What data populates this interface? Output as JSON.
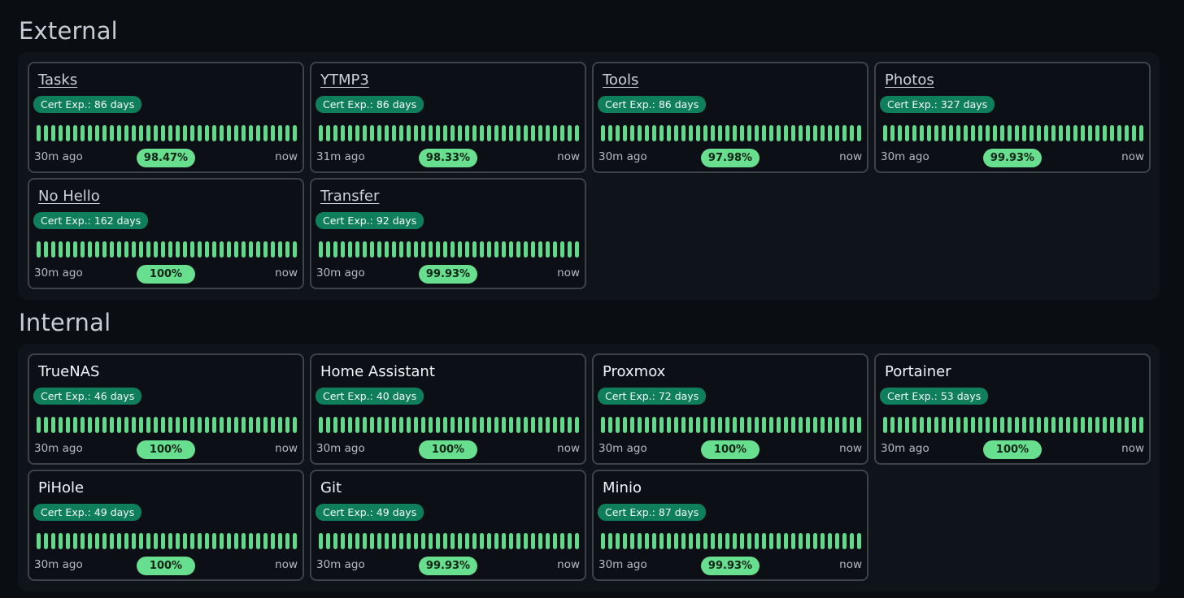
{
  "colors": {
    "background": "#0a0d12",
    "panel": "#0f131a",
    "card_border": "#3f4348",
    "cert_badge": "#0f7e5b",
    "uptime_bar": "#5fd98a",
    "percent_pill": "#67df8e"
  },
  "sections": [
    {
      "title": "External",
      "cards": [
        {
          "name": "Tasks",
          "cert": "Cert Exp.: 86 days",
          "ago": "30m ago",
          "uptime": "98.47%",
          "now": "now"
        },
        {
          "name": "YTMP3",
          "cert": "Cert Exp.: 86 days",
          "ago": "31m ago",
          "uptime": "98.33%",
          "now": "now"
        },
        {
          "name": "Tools",
          "cert": "Cert Exp.: 86 days",
          "ago": "30m ago",
          "uptime": "97.98%",
          "now": "now"
        },
        {
          "name": "Photos",
          "cert": "Cert Exp.: 327 days",
          "ago": "30m ago",
          "uptime": "99.93%",
          "now": "now"
        },
        {
          "name": "No Hello",
          "cert": "Cert Exp.: 162 days",
          "ago": "30m ago",
          "uptime": "100%",
          "now": "now"
        },
        {
          "name": "Transfer",
          "cert": "Cert Exp.: 92 days",
          "ago": "30m ago",
          "uptime": "99.93%",
          "now": "now"
        }
      ]
    },
    {
      "title": "Internal",
      "cards": [
        {
          "name": "TrueNAS",
          "cert": "Cert Exp.: 46 days",
          "ago": "30m ago",
          "uptime": "100%",
          "now": "now"
        },
        {
          "name": "Home Assistant",
          "cert": "Cert Exp.: 40 days",
          "ago": "30m ago",
          "uptime": "100%",
          "now": "now"
        },
        {
          "name": "Proxmox",
          "cert": "Cert Exp.: 72 days",
          "ago": "30m ago",
          "uptime": "100%",
          "now": "now"
        },
        {
          "name": "Portainer",
          "cert": "Cert Exp.: 53 days",
          "ago": "30m ago",
          "uptime": "100%",
          "now": "now"
        },
        {
          "name": "PiHole",
          "cert": "Cert Exp.: 49 days",
          "ago": "30m ago",
          "uptime": "100%",
          "now": "now"
        },
        {
          "name": "Git",
          "cert": "Cert Exp.: 49 days",
          "ago": "30m ago",
          "uptime": "99.93%",
          "now": "now"
        },
        {
          "name": "Minio",
          "cert": "Cert Exp.: 87 days",
          "ago": "30m ago",
          "uptime": "99.93%",
          "now": "now"
        }
      ]
    }
  ]
}
